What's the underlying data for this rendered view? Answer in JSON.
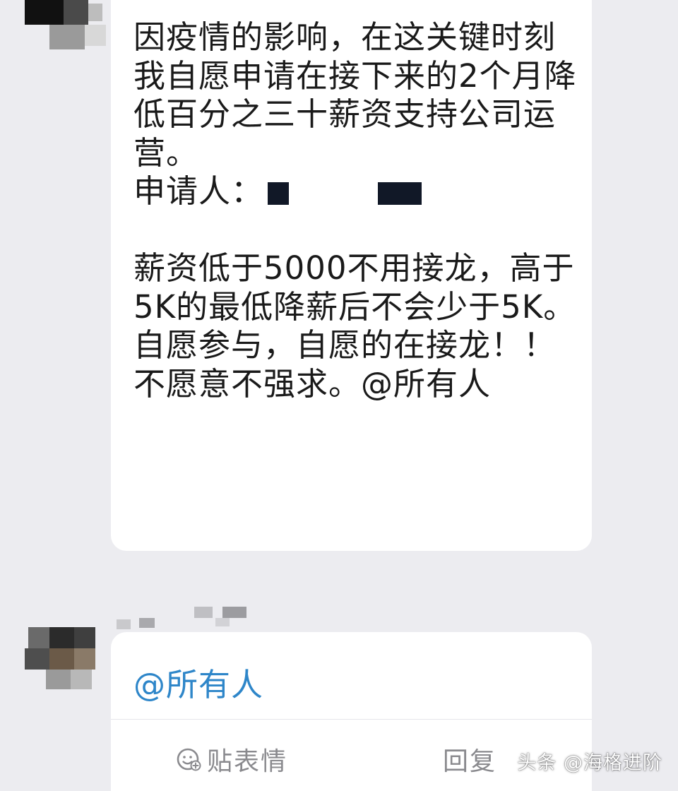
{
  "message": {
    "paragraphs": [
      "因疫情的影响，在这关键时刻我自愿申请在接下来的2个月降低百分之三十薪资支持公司运营。",
      "申请人：",
      "薪资低于5000不用接龙，高于5K的最低降薪后不会少于5K。",
      "自愿参与，自愿的在接龙！！不愿意不强求。@所有人"
    ]
  },
  "reply": {
    "mention": "@所有人",
    "sticker_label": "贴表情",
    "reply_label": "回复"
  },
  "watermark": "头条 @海格进阶",
  "colors": {
    "background": "#ececf0",
    "bubble": "#ffffff",
    "text": "#1a1a1a",
    "mention": "#2e86c9",
    "action": "#8a8a8e"
  }
}
